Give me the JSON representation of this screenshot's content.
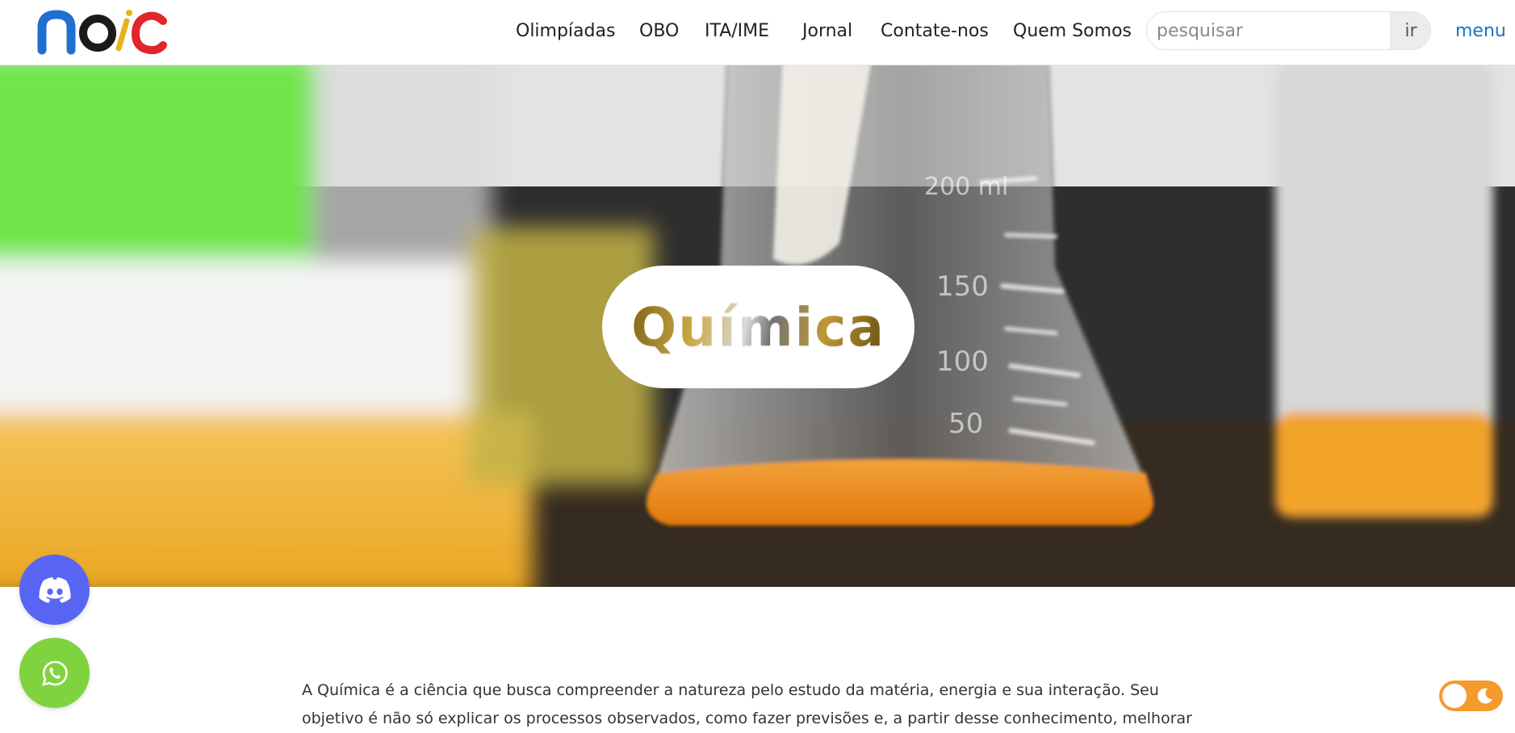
{
  "header": {
    "logo_alt": "noic",
    "nav": [
      {
        "label": "Olimpíadas",
        "name": "nav-olimpiadas"
      },
      {
        "label": "OBO",
        "name": "nav-obo"
      },
      {
        "label": "ITA/IME",
        "name": "nav-ita-ime"
      },
      {
        "label": "Jornal",
        "name": "nav-jornal"
      },
      {
        "label": "Contate-nos",
        "name": "nav-contate-nos"
      },
      {
        "label": "Quem Somos",
        "name": "nav-quem-somos"
      }
    ],
    "search": {
      "placeholder": "pesquisar",
      "value": "",
      "button_label": "ir"
    },
    "menu_label": "menu"
  },
  "hero": {
    "title": "Química",
    "flask_marks": [
      "200 ml",
      "150",
      "100",
      "50"
    ]
  },
  "content": {
    "intro": "A Química é a ciência que busca compreender a natureza pelo estudo da matéria, energia e sua interação. Seu objetivo é não só explicar os processos observados, como fazer previsões e, a partir desse conhecimento, melhorar vidas. por meio"
  },
  "floating": {
    "discord_icon": "discord-icon",
    "whatsapp_icon": "whatsapp-icon",
    "theme_toggle": "theme-toggle"
  },
  "colors": {
    "accent_link": "#1a73c8",
    "discord": "#5865f2",
    "whatsapp": "#7fd33f",
    "toggle": "#f59a2c"
  }
}
